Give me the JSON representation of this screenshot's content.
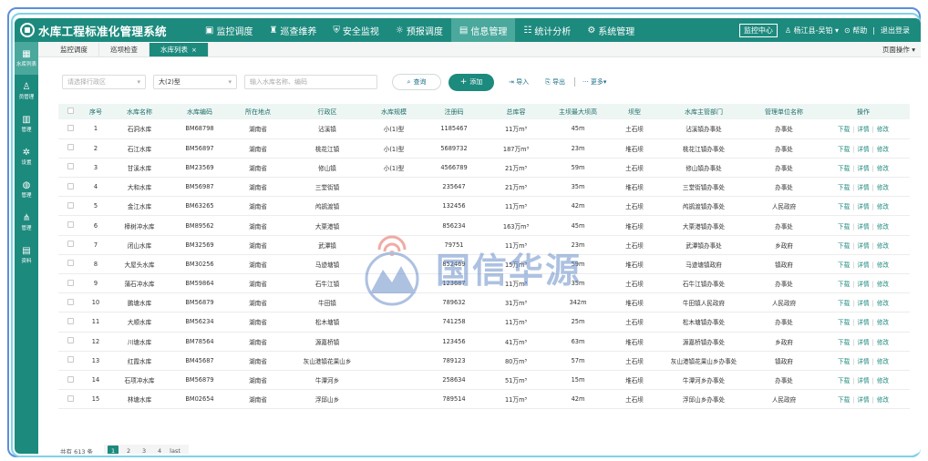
{
  "app": {
    "title": "水库工程标准化管理系统"
  },
  "nav": [
    {
      "label": "监控调度",
      "icon": "monitor-icon",
      "active": false
    },
    {
      "label": "巡查维养",
      "icon": "patrol-icon",
      "active": false
    },
    {
      "label": "安全监视",
      "icon": "shield-icon",
      "active": false
    },
    {
      "label": "预报调度",
      "icon": "forecast-icon",
      "active": false
    },
    {
      "label": "信息管理",
      "icon": "info-icon",
      "active": true
    },
    {
      "label": "统计分析",
      "icon": "stats-icon",
      "active": false
    },
    {
      "label": "系统管理",
      "icon": "settings-icon",
      "active": false
    }
  ],
  "top_right": {
    "monitor_center": "监控中心",
    "user": "杨江县-吴铂",
    "help": "帮助",
    "logout": "退出登录"
  },
  "sidebar": [
    {
      "label": "水库列表",
      "icon": "grid-icon",
      "active": true
    },
    {
      "label": "员管理",
      "icon": "user-icon",
      "active": false
    },
    {
      "label": "管理",
      "icon": "building-icon",
      "active": false
    },
    {
      "label": "设置",
      "icon": "gear-icon",
      "active": false
    },
    {
      "label": "管理",
      "icon": "globe-icon",
      "active": false
    },
    {
      "label": "管理",
      "icon": "network-icon",
      "active": false
    },
    {
      "label": "资料",
      "icon": "document-icon",
      "active": false
    }
  ],
  "tabs": [
    {
      "label": "监控调度",
      "active": false
    },
    {
      "label": "巡坝检查",
      "active": false
    },
    {
      "label": "水库列表",
      "active": true,
      "closable": true
    }
  ],
  "page_ops": "页面操作",
  "filters": {
    "region_placeholder": "请选择行政区",
    "scale_value": "大(2)型",
    "search_placeholder": "输入水库名称、编码",
    "query_label": "查询",
    "add_label": "添加",
    "import_label": "导入",
    "export_label": "导出",
    "more_label": "更多"
  },
  "table": {
    "columns": [
      "",
      "序号",
      "水库名称",
      "水库编码",
      "所在地点",
      "行政区",
      "水库规模",
      "注册码",
      "总库容",
      "主坝最大坝高",
      "坝型",
      "水库主管部门",
      "管理单位名称",
      "操作"
    ],
    "rows": [
      [
        "1",
        "石洞水库",
        "BM68798",
        "湖南省",
        "沾溪镇",
        "小(1)型",
        "1185467",
        "11万m³",
        "45m",
        "土石坝",
        "沾溪镇办事处",
        "办事处"
      ],
      [
        "2",
        "石江水库",
        "BM56897",
        "湖南省",
        "桃花江镇",
        "小(1)型",
        "5689732",
        "187万m³",
        "23m",
        "堆石坝",
        "桃花江镇办事处",
        "办事处"
      ],
      [
        "3",
        "甘溪水库",
        "BM23569",
        "湖南省",
        "修山镇",
        "小(1)型",
        "4566789",
        "21万m³",
        "59m",
        "土石坝",
        "修山镇办事处",
        "办事处"
      ],
      [
        "4",
        "大和水库",
        "BM56987",
        "湖南省",
        "三堂街镇",
        "",
        "235647",
        "21万m³",
        "35m",
        "堆石坝",
        "三堂街镇办事处",
        "办事处"
      ],
      [
        "5",
        "金江水库",
        "BM63265",
        "湖南省",
        "鸬鹚渡镇",
        "",
        "132456",
        "11万m³",
        "42m",
        "土石坝",
        "鸬鹚渡镇办事处",
        "人民政府"
      ],
      [
        "6",
        "樟树冲水库",
        "BM89562",
        "湖南省",
        "大栗港镇",
        "",
        "856234",
        "163万m³",
        "45m",
        "堆石坝",
        "大栗港镇办事处",
        "办事处"
      ],
      [
        "7",
        "闭山水库",
        "BM32569",
        "湖南省",
        "武潭镇",
        "",
        "79751",
        "11万m³",
        "23m",
        "土石坝",
        "武潭镇办事处",
        "乡政府"
      ],
      [
        "8",
        "大屋头水库",
        "BM30256",
        "湖南省",
        "马迹塘镇",
        "",
        "852469",
        "15万m³",
        "59m",
        "堆石坝",
        "马迹塘镇政府",
        "镇政府"
      ],
      [
        "9",
        "蒲石冲水库",
        "BM59864",
        "湖南省",
        "石牛江镇",
        "",
        "123687",
        "11万m³",
        "35m",
        "土石坝",
        "石牛江镇办事处",
        "办事处"
      ],
      [
        "10",
        "鹏塘水库",
        "BM56879",
        "湖南省",
        "牛田镇",
        "",
        "789632",
        "31万m³",
        "342m",
        "堆石坝",
        "牛田镇人民政府",
        "人民政府"
      ],
      [
        "11",
        "大顺水库",
        "BM56234",
        "湖南省",
        "松木塘镇",
        "",
        "741258",
        "11万m³",
        "25m",
        "土石坝",
        "松木塘镇办事处",
        "办事处"
      ],
      [
        "12",
        "川塘水库",
        "BM78564",
        "湖南省",
        "源嘉桥镇",
        "",
        "123456",
        "41万m³",
        "63m",
        "堆石坝",
        "源嘉桥镇办事处",
        "乡政府"
      ],
      [
        "13",
        "红霞水库",
        "BM45687",
        "湖南省",
        "灰山港镇花果山乡",
        "",
        "789123",
        "80万m³",
        "57m",
        "土石坝",
        "灰山港镇花果山乡办事处",
        "镇政府"
      ],
      [
        "14",
        "石项冲水库",
        "BM56879",
        "湖南省",
        "牛潭河乡",
        "",
        "258634",
        "51万m³",
        "15m",
        "堆石坝",
        "牛潭河乡办事处",
        "办事处"
      ],
      [
        "15",
        "林塘水库",
        "BM02654",
        "湖南省",
        "浮邱山乡",
        "",
        "789514",
        "11万m³",
        "42m",
        "土石坝",
        "浮邱山乡办事处",
        "人民政府"
      ]
    ],
    "op_download": "下载",
    "op_detail": "详情",
    "op_edit": "修改"
  },
  "pager": {
    "total": "共有 613 条",
    "pages": [
      "1",
      "2",
      "3",
      "4",
      "last"
    ],
    "current": "1"
  },
  "watermark": "国信华源"
}
